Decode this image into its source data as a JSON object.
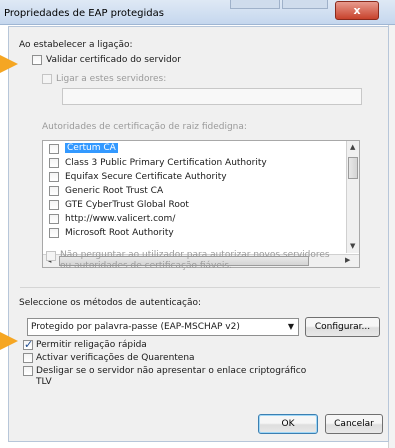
{
  "window": {
    "title": "Propriedades de EAP protegidas",
    "close_label": "x"
  },
  "connection": {
    "heading": "Ao estabelecer a ligação:",
    "validate_cert": {
      "label": "Validar certificado do servidor",
      "checked": false
    },
    "connect_servers": {
      "label": "Ligar a estes servidores:",
      "checked": false,
      "enabled": false,
      "value": ""
    }
  },
  "root_ca": {
    "heading": "Autoridades de certificação de raiz fidedigna:",
    "items": [
      {
        "label": "Certum CA",
        "checked": false,
        "selected": true
      },
      {
        "label": "Class 3 Public Primary Certification Authority",
        "checked": false,
        "selected": false
      },
      {
        "label": "Equifax Secure Certificate Authority",
        "checked": false,
        "selected": false
      },
      {
        "label": "Generic Root Trust CA",
        "checked": false,
        "selected": false
      },
      {
        "label": "GTE CyberTrust Global Root",
        "checked": false,
        "selected": false
      },
      {
        "label": "http://www.valicert.com/",
        "checked": false,
        "selected": false
      },
      {
        "label": "Microsoft Root Authority",
        "checked": false,
        "selected": false
      }
    ]
  },
  "no_prompt": {
    "label_line1": "Não perguntar ao utilizador para autorizar novos servidores",
    "label_line2": "ou autoridades de certificação fiáveis.",
    "checked": false
  },
  "auth": {
    "heading": "Seleccione os métodos de autenticação:",
    "method": "Protegido por palavra-passe (EAP-MSCHAP v2)",
    "configure_label": "Configurar..."
  },
  "options": {
    "fast_reconnect": {
      "label": "Permitir religação rápida",
      "checked": true
    },
    "quarantine": {
      "label": "Activar verificações de Quarentena",
      "checked": false
    },
    "disconnect_line1": "Desligar se o servidor não apresentar o enlace criptográfico",
    "disconnect_line2": "TLV",
    "disconnect_checked": false
  },
  "buttons": {
    "ok": "OK",
    "cancel": "Cancelar"
  },
  "colors": {
    "pointer": "#f5a623",
    "selection": "#3399ff"
  }
}
